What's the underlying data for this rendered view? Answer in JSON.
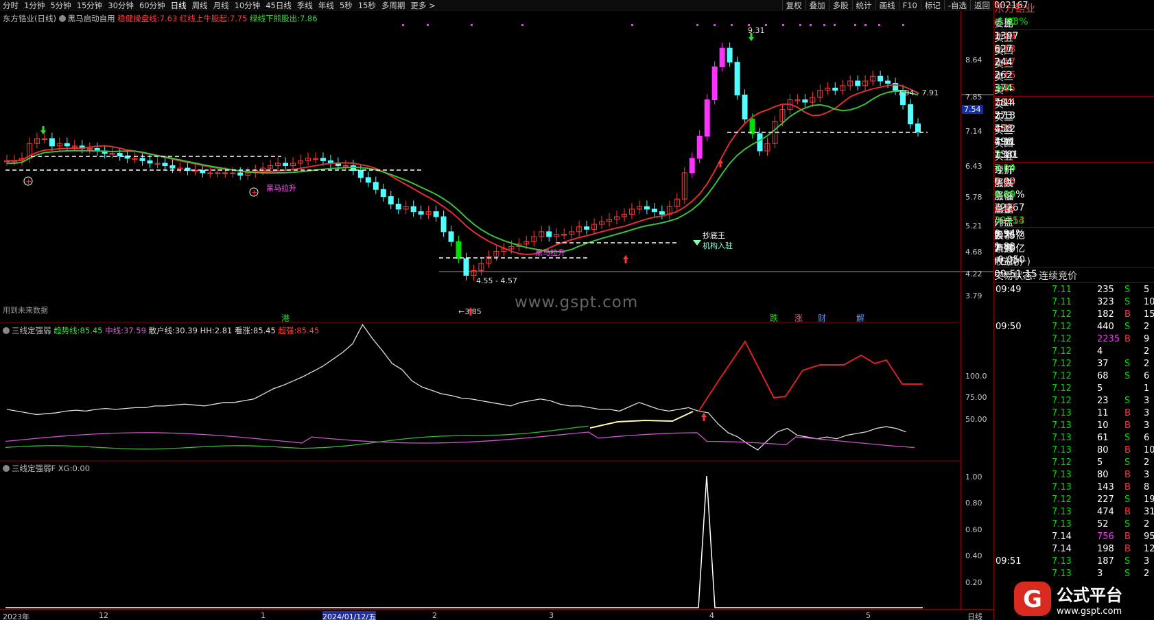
{
  "toolbar": {
    "periods": [
      "分时",
      "1分钟",
      "5分钟",
      "15分钟",
      "30分钟",
      "60分钟",
      "日线",
      "周线",
      "月线",
      "10分钟",
      "45日线",
      "季线",
      "年线",
      "5秒",
      "15秒",
      "多周期",
      "更多 >"
    ],
    "right": [
      "复权",
      "叠加",
      "多股",
      "统计",
      "画线",
      "F10",
      "标记",
      "-自选",
      "返回"
    ]
  },
  "pane1": {
    "stock": "东方锆业(日线)",
    "indicator": "黑马启动自用",
    "l1": "稳健操盘线:",
    "v1": "7.63",
    "l2": "红线上牛股起:",
    "v2": "7.75",
    "l3": "绿线下熊股出:",
    "v3": "7.86",
    "yticks": [
      "8.64",
      "7.85",
      "7.14",
      "6.43",
      "5.78",
      "5.21",
      "4.68",
      "4.22",
      "3.79"
    ],
    "price_tag": "7.54",
    "ann_high": "9.31",
    "ann_range1": "7.94 - 7.91",
    "ann_range2": "4.55 - 4.57",
    "ann_low": "3.85",
    "label_hm": "黑马拉升",
    "label_hm2": "黑马拉升",
    "label_cd": "抄底王",
    "label_jg": "机构入驻",
    "future": "用到未来数据",
    "events": [
      "港",
      "跌",
      "涨",
      "财",
      "解"
    ]
  },
  "pane2": {
    "title": "三线定强弱",
    "l1": "趋势线:",
    "v1": "85.45",
    "l2": "中线:",
    "v2": "37.59",
    "l3": "散户线:",
    "v3": "30.39",
    "l4": "HH:",
    "v4": "2.81",
    "l5": "看涨:",
    "v5": "85.45",
    "l6": "超强:",
    "v6": "85.45",
    "yticks": [
      "100.0",
      "75.00",
      "50.00"
    ]
  },
  "pane3": {
    "title": "三线定强弱F",
    "l1": "XG:",
    "v1": "0.00",
    "yticks": [
      "1.00",
      "0.80",
      "0.60",
      "0.40",
      "0.20"
    ]
  },
  "xaxis": {
    "labels": [
      "2023年",
      "12",
      "1",
      "2024/01/12/五",
      "2",
      "3",
      "4",
      "5"
    ],
    "right": "日线"
  },
  "watermark": "www.gspt.com",
  "quote": {
    "code": "002167",
    "name": "东方锆业",
    "wb_label": "委比",
    "wb": "-1.93%",
    "wc_label": "委差",
    "wc": "-110",
    "asks": [
      {
        "l": "卖五",
        "p": "7.19",
        "v": "1397"
      },
      {
        "l": "卖四",
        "p": "7.18",
        "v": "627"
      },
      {
        "l": "卖三",
        "p": "7.17",
        "v": "244"
      },
      {
        "l": "卖二",
        "p": "7.16",
        "v": "262"
      },
      {
        "l": "卖一",
        "p": "7.15",
        "v": "374",
        "c": "-695"
      }
    ],
    "bids": [
      {
        "l": "买一",
        "p": "7.14",
        "v": "184",
        "c": "+177"
      },
      {
        "l": "买二",
        "p": "7.13",
        "v": "273",
        "c": ""
      },
      {
        "l": "买三",
        "p": "7.12",
        "v": "458",
        "c": "+22"
      },
      {
        "l": "买四",
        "p": "7.11",
        "v": "498",
        "c": ""
      },
      {
        "l": "买五",
        "p": "7.10",
        "v": "1381",
        "c": "-2"
      }
    ],
    "stats": [
      [
        "现价",
        "7.14",
        "今开",
        "7.09"
      ],
      [
        "涨跌",
        "0.00",
        "最高",
        "7.15"
      ],
      [
        "涨幅",
        "0.00%",
        "最低",
        "6.99"
      ],
      [
        "总量",
        "72267",
        "量比",
        "1.22"
      ],
      [
        "外盘",
        "39714",
        "内盘",
        "32553"
      ],
      [
        "换手",
        "0.94%",
        "股本",
        "7.75亿"
      ],
      [
        "净资",
        "1.83",
        "流通",
        "7.70亿"
      ],
      [
        "收益(一)",
        "-0.050",
        "PE(动)",
        "—"
      ]
    ],
    "status": "交易状态: 连续竞价",
    "time": "09:51:15"
  },
  "ticks": [
    [
      "09:49",
      "7.11",
      "235",
      "S",
      "5"
    ],
    [
      "",
      "7.11",
      "323",
      "S",
      "10"
    ],
    [
      "",
      "7.12",
      "182",
      "B",
      "15"
    ],
    [
      "09:50",
      "7.12",
      "440",
      "S",
      "2"
    ],
    [
      "",
      "7.12",
      "2235",
      "B",
      "9"
    ],
    [
      "",
      "7.12",
      "4",
      "",
      "2"
    ],
    [
      "",
      "7.12",
      "37",
      "S",
      "2"
    ],
    [
      "",
      "7.12",
      "68",
      "S",
      "6"
    ],
    [
      "",
      "7.12",
      "5",
      "",
      "1"
    ],
    [
      "",
      "7.12",
      "23",
      "S",
      "3"
    ],
    [
      "",
      "7.13",
      "11",
      "B",
      "3"
    ],
    [
      "",
      "7.13",
      "10",
      "B",
      "3"
    ],
    [
      "",
      "7.13",
      "61",
      "S",
      "6"
    ],
    [
      "",
      "7.13",
      "80",
      "B",
      "10"
    ],
    [
      "",
      "7.12",
      "5",
      "S",
      "2"
    ],
    [
      "",
      "7.13",
      "80",
      "B",
      "3"
    ],
    [
      "",
      "7.13",
      "143",
      "B",
      "8"
    ],
    [
      "",
      "7.12",
      "227",
      "S",
      "19"
    ],
    [
      "",
      "7.13",
      "474",
      "B",
      "31"
    ],
    [
      "",
      "7.13",
      "52",
      "S",
      "2"
    ],
    [
      "",
      "7.14",
      "756",
      "B",
      "95"
    ],
    [
      "",
      "7.14",
      "198",
      "B",
      "12"
    ],
    [
      "09:51",
      "7.13",
      "187",
      "S",
      "3"
    ],
    [
      "",
      "7.13",
      "3",
      "S",
      "2"
    ]
  ],
  "logo": {
    "text": "公式平台",
    "url": "www.gspt.com"
  },
  "colors": {
    "up": "#ff3b3b",
    "down": "#54ffff",
    "magenta": "#ff33ff",
    "green": "#00dd00"
  }
}
